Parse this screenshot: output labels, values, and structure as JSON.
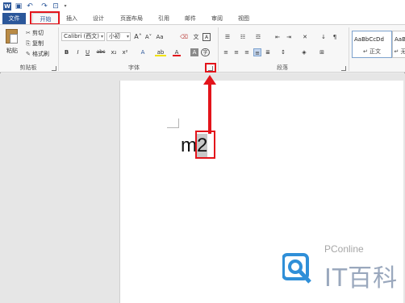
{
  "tabs": [
    {
      "label": "文件"
    },
    {
      "label": "开始"
    },
    {
      "label": "插入"
    },
    {
      "label": "设计"
    },
    {
      "label": "页面布局"
    },
    {
      "label": "引用"
    },
    {
      "label": "邮件"
    },
    {
      "label": "审阅"
    },
    {
      "label": "视图"
    }
  ],
  "clipboard": {
    "paste_label": "粘贴",
    "cut_label": "剪切",
    "copy_label": "复制",
    "format_painter_label": "格式刷",
    "group_label": "剪贴板"
  },
  "font": {
    "font_name": "Calibri (西文)",
    "font_size": "小初",
    "bold": "B",
    "italic": "I",
    "underline": "U",
    "strikethrough": "abc",
    "subscript": "x₂",
    "superscript": "x²",
    "group_label": "字体"
  },
  "paragraph": {
    "group_label": "段落"
  },
  "styles": [
    {
      "preview": "AaBbCcDd",
      "name": "↵ 正文"
    },
    {
      "preview": "AaBbCcDd",
      "name": "↵ 无"
    }
  ],
  "document": {
    "text_before": "m",
    "text_selected": "2"
  },
  "watermark": {
    "brand": "PConline",
    "mark": "IT百科"
  },
  "colors": {
    "accent": "#2b579a",
    "annotation": "#e3141b"
  }
}
